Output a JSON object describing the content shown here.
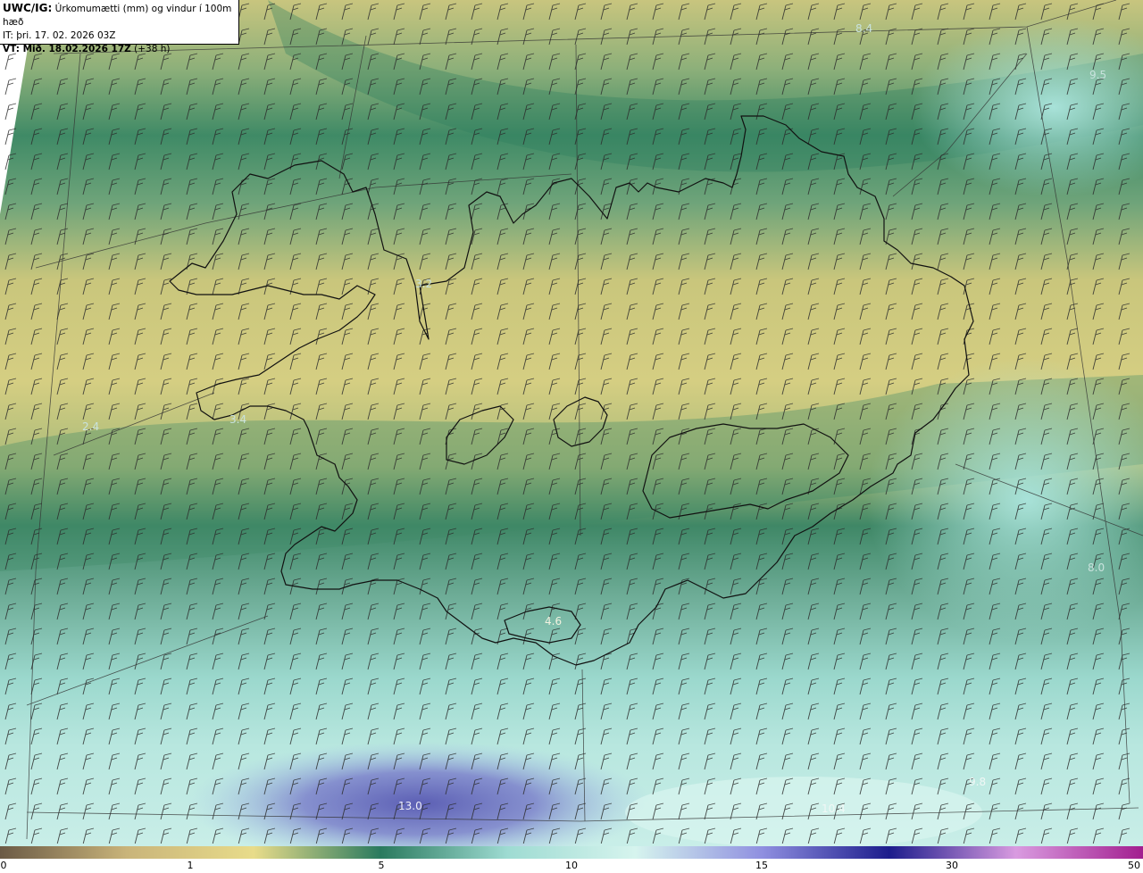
{
  "header": {
    "model": "UWC/IG:",
    "title": "Úrkomumætti (mm) og vindur í 100m hæð",
    "it_line": "IT: þri. 17. 02. 2026 03Z",
    "vt_label": "VT: Mið. 18.02.2026 17Z",
    "vt_offset": "(+38 h)"
  },
  "field_labels": [
    {
      "text": "8.4"
    },
    {
      "text": "3.2"
    },
    {
      "text": "3.4"
    },
    {
      "text": "2.4"
    },
    {
      "text": "4.6"
    },
    {
      "text": "13.0"
    },
    {
      "text": "9.8"
    },
    {
      "text": "10.4"
    },
    {
      "text": "8.0"
    },
    {
      "text": "9.5"
    }
  ],
  "colorbar": {
    "ticks": [
      "0",
      "1",
      "5",
      "10",
      "15",
      "30",
      "50"
    ],
    "colors": [
      "#6b5a45",
      "#c9b47a",
      "#e8dc8a",
      "#2a7a5e",
      "#9edbd2",
      "#d6f4ee",
      "#8f8fe0",
      "#1c1c8c",
      "#d99be0",
      "#a21e8f"
    ]
  }
}
